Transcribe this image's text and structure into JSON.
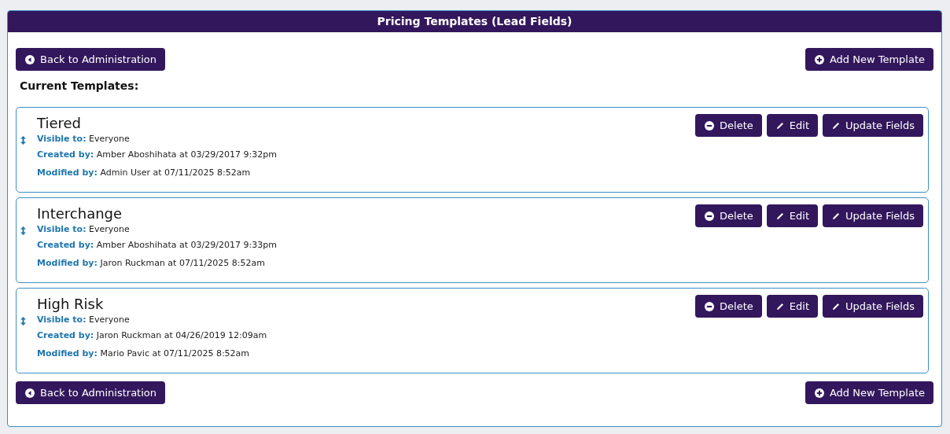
{
  "window": {
    "title": "Pricing Templates (Lead Fields)"
  },
  "top_actions": [
    {
      "label": "Back to Administration",
      "kind": "back"
    },
    {
      "label": "Add New Template",
      "kind": "add"
    }
  ],
  "section_title": "Current Templates:",
  "templates": [
    {
      "name": "Tiered",
      "visible_label": "Visible to:",
      "visible": "Everyone",
      "created_label": "Created by:",
      "created": "Amber Aboshihata at 03/29/2017 9:32pm",
      "modified_label": "Modified by:",
      "modified": "Admin User at 07/11/2025 8:52am",
      "actions": [
        {
          "label": "Delete",
          "kind": "delete"
        },
        {
          "label": "Edit",
          "kind": "edit"
        },
        {
          "label": "Update Fields",
          "kind": "edit"
        }
      ]
    },
    {
      "name": "Interchange",
      "visible_label": "Visible to:",
      "visible": "Everyone",
      "created_label": "Created by:",
      "created": "Amber Aboshihata at 03/29/2017 9:33pm",
      "modified_label": "Modified by:",
      "modified": "Jaron Ruckman at 07/11/2025 8:52am",
      "actions": [
        {
          "label": "Delete",
          "kind": "delete"
        },
        {
          "label": "Edit",
          "kind": "edit"
        },
        {
          "label": "Update Fields",
          "kind": "edit"
        }
      ]
    },
    {
      "name": "High Risk",
      "visible_label": "Visible to:",
      "visible": "Everyone",
      "created_label": "Created by:",
      "created": "Jaron Ruckman at 04/26/2019 12:09am",
      "modified_label": "Modified by:",
      "modified": "Mario Pavic at 07/11/2025 8:52am",
      "actions": [
        {
          "label": "Delete",
          "kind": "delete"
        },
        {
          "label": "Edit",
          "kind": "edit"
        },
        {
          "label": "Update Fields",
          "kind": "edit"
        }
      ]
    }
  ],
  "bottom_actions": [
    {
      "label": "Back to Administration",
      "kind": "back"
    },
    {
      "label": "Add New Template",
      "kind": "add"
    }
  ]
}
